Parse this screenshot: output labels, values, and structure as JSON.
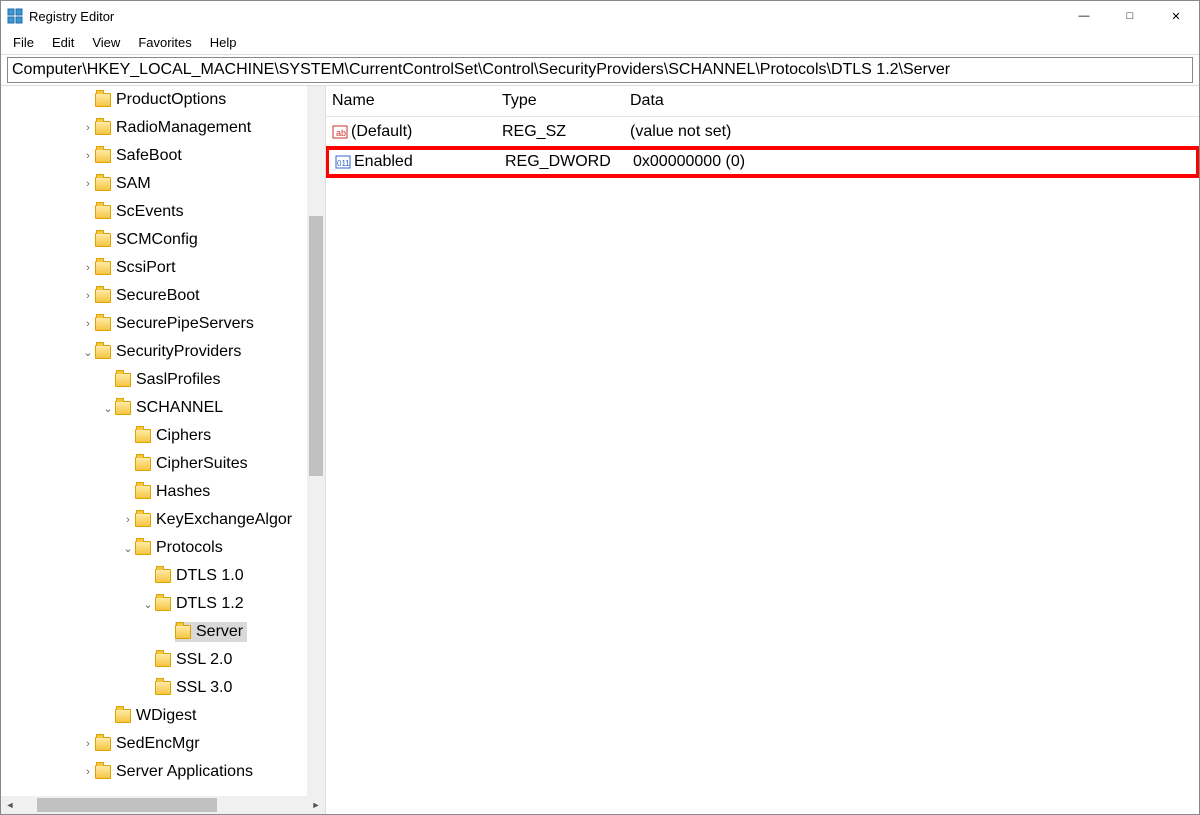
{
  "window": {
    "title": "Registry Editor"
  },
  "menu": {
    "file": "File",
    "edit": "Edit",
    "view": "View",
    "favorites": "Favorites",
    "help": "Help"
  },
  "address": {
    "value": "Computer\\HKEY_LOCAL_MACHINE\\SYSTEM\\CurrentControlSet\\Control\\SecurityProviders\\SCHANNEL\\Protocols\\DTLS 1.2\\Server"
  },
  "tree": {
    "items": [
      {
        "indent": 0,
        "expander": "",
        "label": "ProductOptions"
      },
      {
        "indent": 0,
        "expander": ">",
        "label": "RadioManagement"
      },
      {
        "indent": 0,
        "expander": ">",
        "label": "SafeBoot"
      },
      {
        "indent": 0,
        "expander": ">",
        "label": "SAM"
      },
      {
        "indent": 0,
        "expander": "",
        "label": "ScEvents"
      },
      {
        "indent": 0,
        "expander": "",
        "label": "SCMConfig"
      },
      {
        "indent": 0,
        "expander": ">",
        "label": "ScsiPort"
      },
      {
        "indent": 0,
        "expander": ">",
        "label": "SecureBoot"
      },
      {
        "indent": 0,
        "expander": ">",
        "label": "SecurePipeServers"
      },
      {
        "indent": 0,
        "expander": "v",
        "label": "SecurityProviders"
      },
      {
        "indent": 1,
        "expander": "",
        "label": "SaslProfiles"
      },
      {
        "indent": 1,
        "expander": "v",
        "label": "SCHANNEL"
      },
      {
        "indent": 2,
        "expander": "",
        "label": "Ciphers"
      },
      {
        "indent": 2,
        "expander": "",
        "label": "CipherSuites"
      },
      {
        "indent": 2,
        "expander": "",
        "label": "Hashes"
      },
      {
        "indent": 2,
        "expander": ">",
        "label": "KeyExchangeAlgorithms",
        "clip": "KeyExchangeAlgor"
      },
      {
        "indent": 2,
        "expander": "v",
        "label": "Protocols"
      },
      {
        "indent": 3,
        "expander": "",
        "label": "DTLS 1.0"
      },
      {
        "indent": 3,
        "expander": "v",
        "label": "DTLS 1.2"
      },
      {
        "indent": 4,
        "expander": "",
        "label": "Server",
        "selected": true
      },
      {
        "indent": 3,
        "expander": "",
        "label": "SSL 2.0"
      },
      {
        "indent": 3,
        "expander": "",
        "label": "SSL 3.0"
      },
      {
        "indent": 1,
        "expander": "",
        "label": "WDigest"
      },
      {
        "indent": 0,
        "expander": ">",
        "label": "SedEncMgr"
      },
      {
        "indent": 0,
        "expander": ">",
        "label": "Server Applications"
      }
    ]
  },
  "list": {
    "headers": {
      "name": "Name",
      "type": "Type",
      "data": "Data"
    },
    "rows": [
      {
        "icon": "string",
        "name": "(Default)",
        "type": "REG_SZ",
        "data": "(value not set)",
        "highlight": false
      },
      {
        "icon": "binary",
        "name": "Enabled",
        "type": "REG_DWORD",
        "data": "0x00000000 (0)",
        "highlight": true
      }
    ]
  }
}
